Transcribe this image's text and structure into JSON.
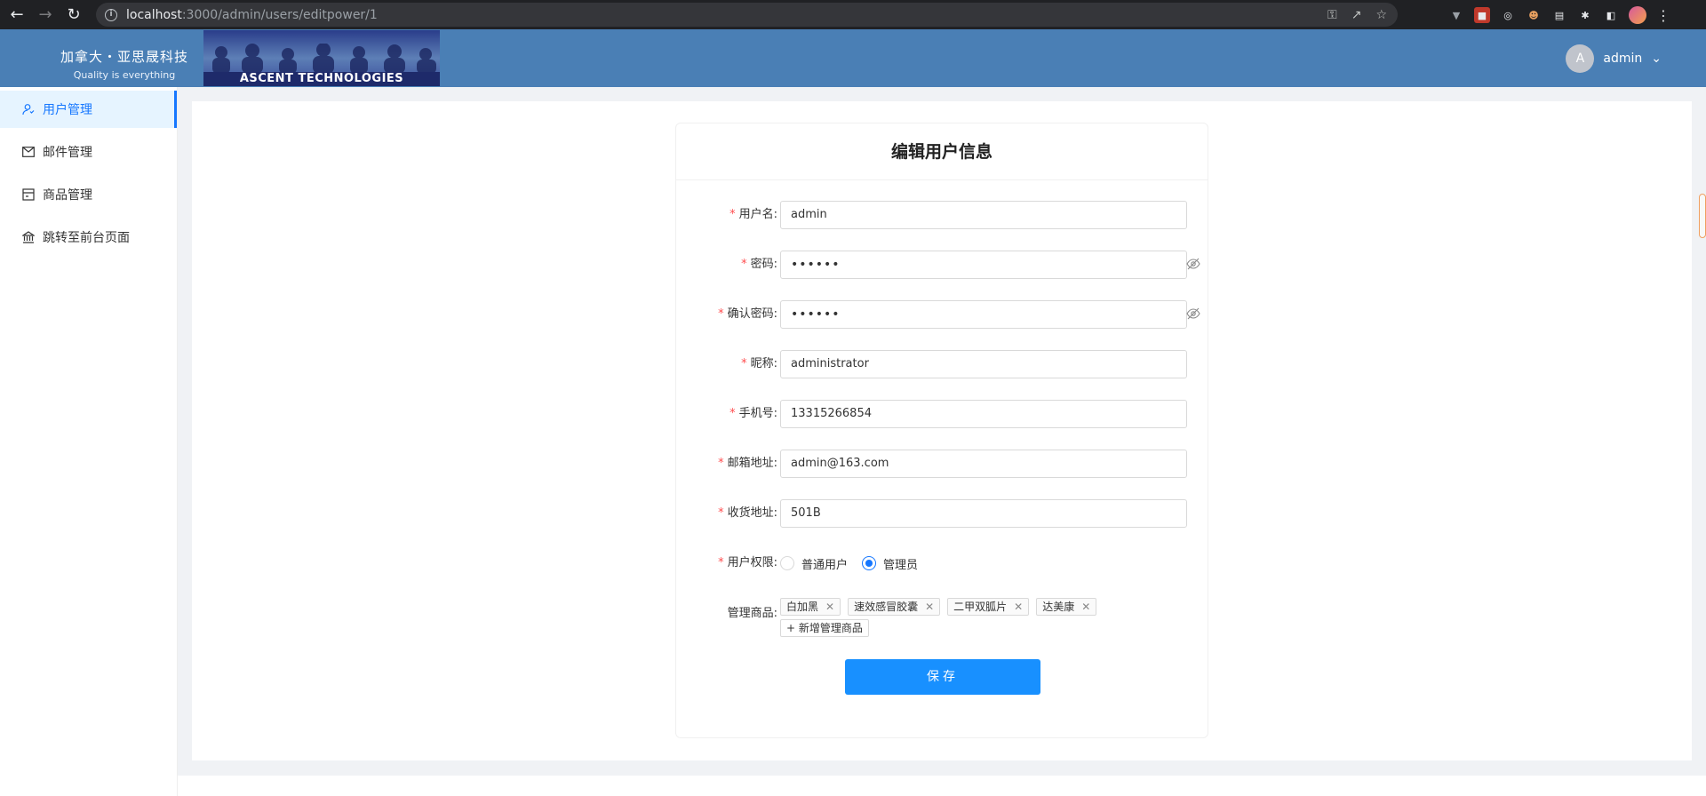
{
  "browser": {
    "url_host": "localhost",
    "url_path": ":3000/admin/users/editpower/1"
  },
  "header": {
    "logo_cn": "加拿大・亚思晟科技",
    "logo_en": "Quality is everything",
    "banner_text": "ASCENT TECHNOLOGIES",
    "avatar_letter": "A",
    "username": "admin"
  },
  "sidebar": {
    "items": [
      {
        "label": "用户管理",
        "icon": "user-icon",
        "active": true
      },
      {
        "label": "邮件管理",
        "icon": "mail-icon"
      },
      {
        "label": "商品管理",
        "icon": "shop-icon"
      },
      {
        "label": "跳转至前台页面",
        "icon": "bank-icon"
      }
    ]
  },
  "form": {
    "title": "编辑用户信息",
    "fields": {
      "username": {
        "label": "用户名:",
        "value": "admin"
      },
      "password": {
        "label": "密码:",
        "value": "••••••"
      },
      "confirm_password": {
        "label": "确认密码:",
        "value": "••••••"
      },
      "nickname": {
        "label": "昵称:",
        "value": "administrator"
      },
      "phone": {
        "label": "手机号:",
        "value": "13315266854"
      },
      "email": {
        "label": "邮箱地址:",
        "value": "admin@163.com"
      },
      "address": {
        "label": "收货地址:",
        "value": "501B"
      }
    },
    "permission": {
      "label": "用户权限:",
      "options": [
        "普通用户",
        "管理员"
      ],
      "selected": "管理员"
    },
    "products": {
      "label": "管理商品:",
      "tags": [
        "白加黑",
        "速效感冒胶囊",
        "二甲双胍片",
        "达美康"
      ],
      "add_label": "+ 新增管理商品"
    },
    "save_label": "保存"
  },
  "colors": {
    "primary": "#1890ff",
    "header_bg": "#4a7fb5",
    "required": "#ff4d4f"
  }
}
